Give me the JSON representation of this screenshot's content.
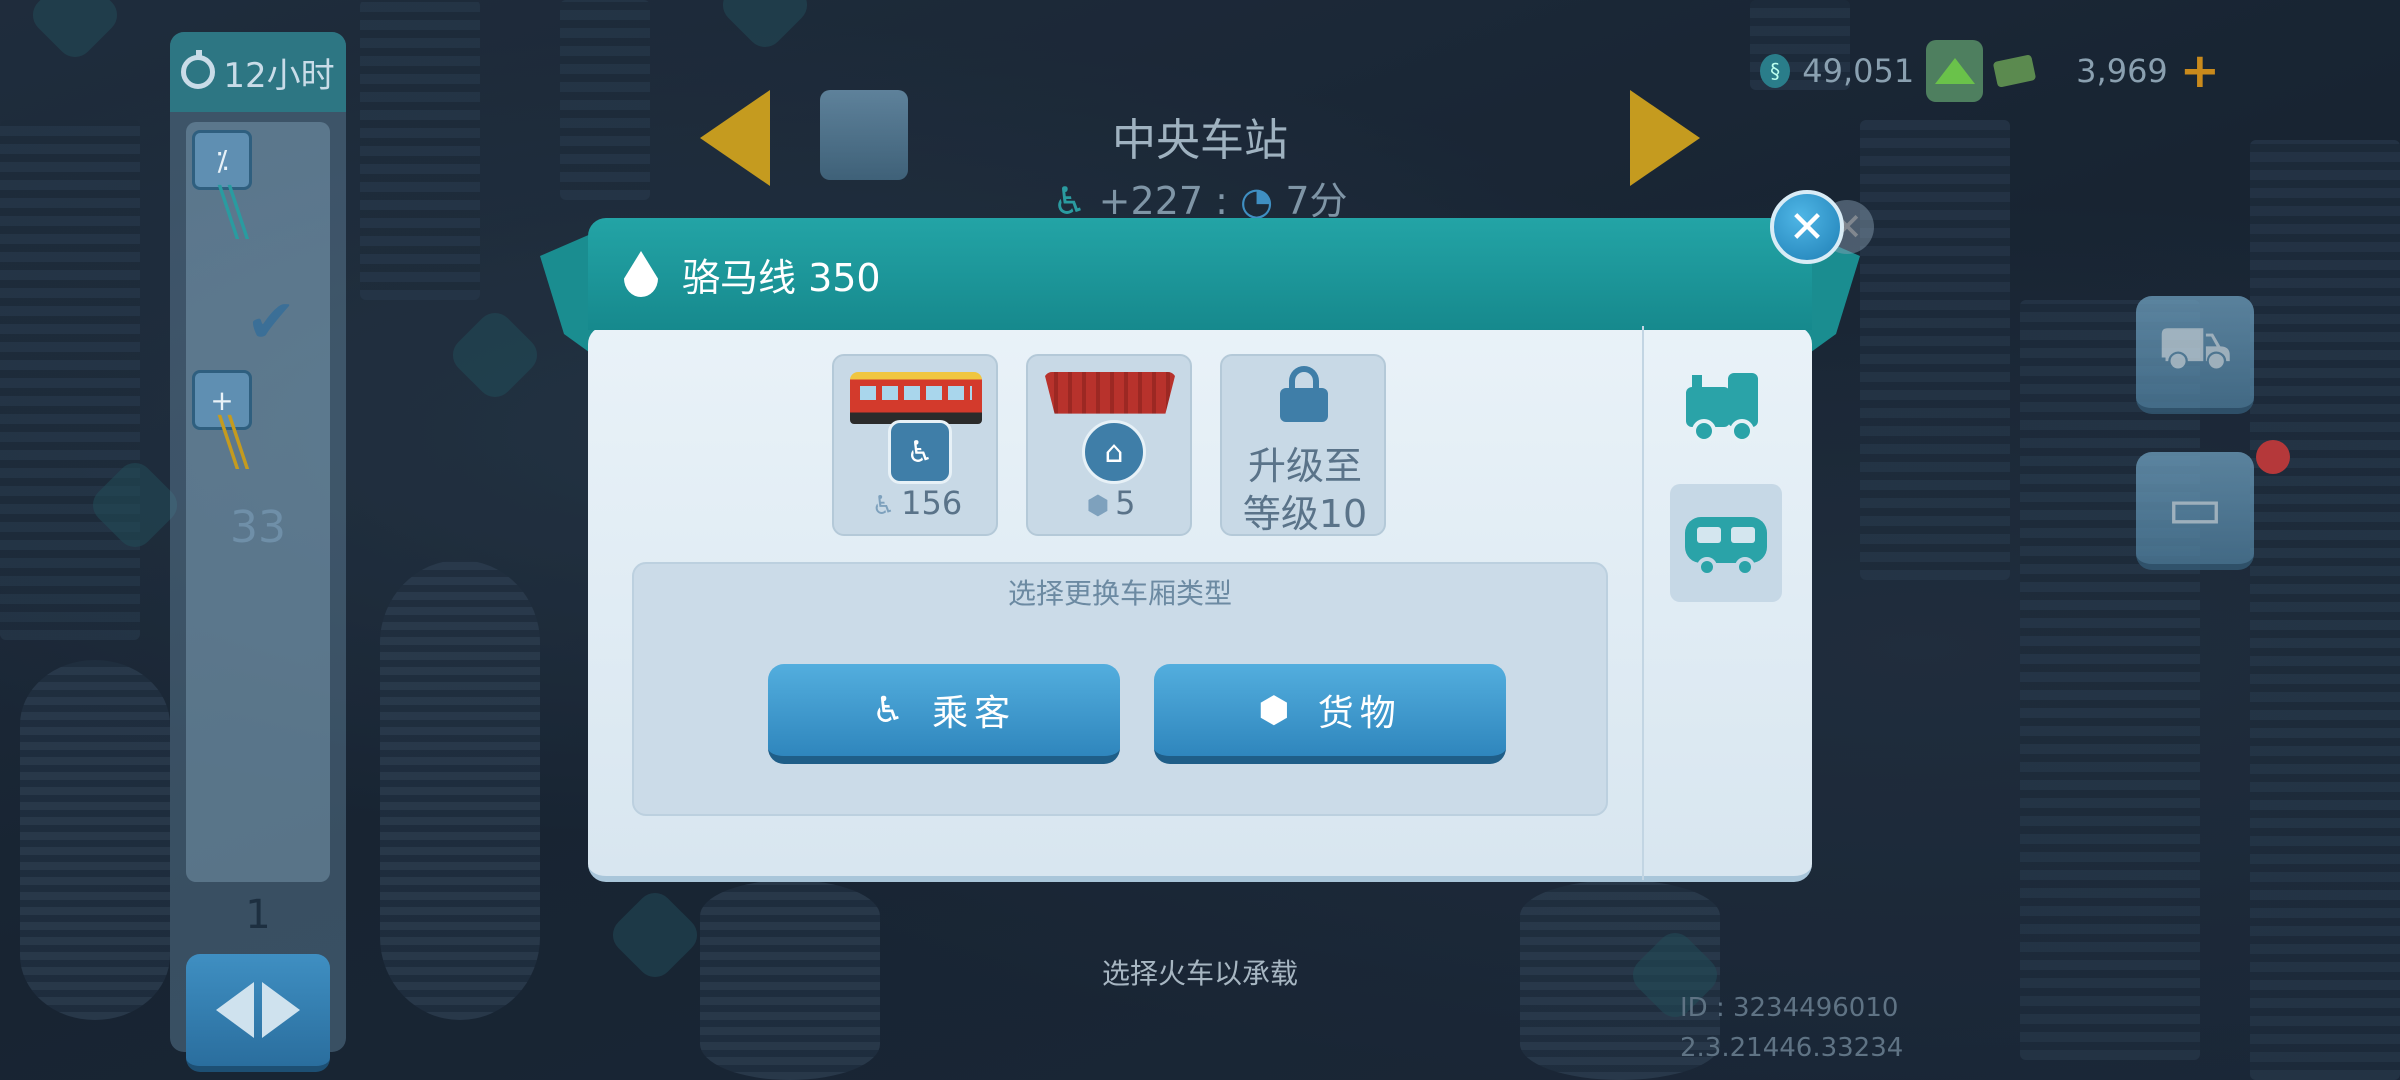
{
  "left_panel": {
    "timer_label": "12小时",
    "capacity_count": "33",
    "page_number": "1"
  },
  "station": {
    "title": "中央车站",
    "passengers_delta": "+227",
    "separator": ":",
    "time": "7分"
  },
  "currency": {
    "simoleons": "49,051",
    "cash": "3,969"
  },
  "modal": {
    "title": "骆马线 350",
    "cars": [
      {
        "type": "passenger",
        "count": "156"
      },
      {
        "type": "cargo",
        "count": "5"
      },
      {
        "type": "locked",
        "label_line1": "升级至",
        "label_line2": "等级10"
      }
    ],
    "select_label": "选择更换车厢类型",
    "passenger_button": "乘客",
    "cargo_button": "货物"
  },
  "bottom_hint": "选择火车以承载",
  "debug": {
    "id_line": "ID : 3234496010",
    "version_line": "2.3.21446.33234"
  },
  "colors": {
    "header_teal": "#1a9598",
    "button_blue": "#3f97cc",
    "accent_yellow": "#c59b1f"
  },
  "icons": [
    "timer-icon",
    "seat-icon",
    "check-icon",
    "arrows-icon",
    "station-icon",
    "simoleon-icon",
    "upgrade-arrow-icon",
    "cash-icon",
    "plus-icon",
    "shopping-bag-icon",
    "ticket-icon",
    "drop-icon",
    "close-icon",
    "passenger-car-icon",
    "cargo-car-icon",
    "lock-icon",
    "locomotive-icon",
    "carriage-icon",
    "hexagon-icon"
  ]
}
